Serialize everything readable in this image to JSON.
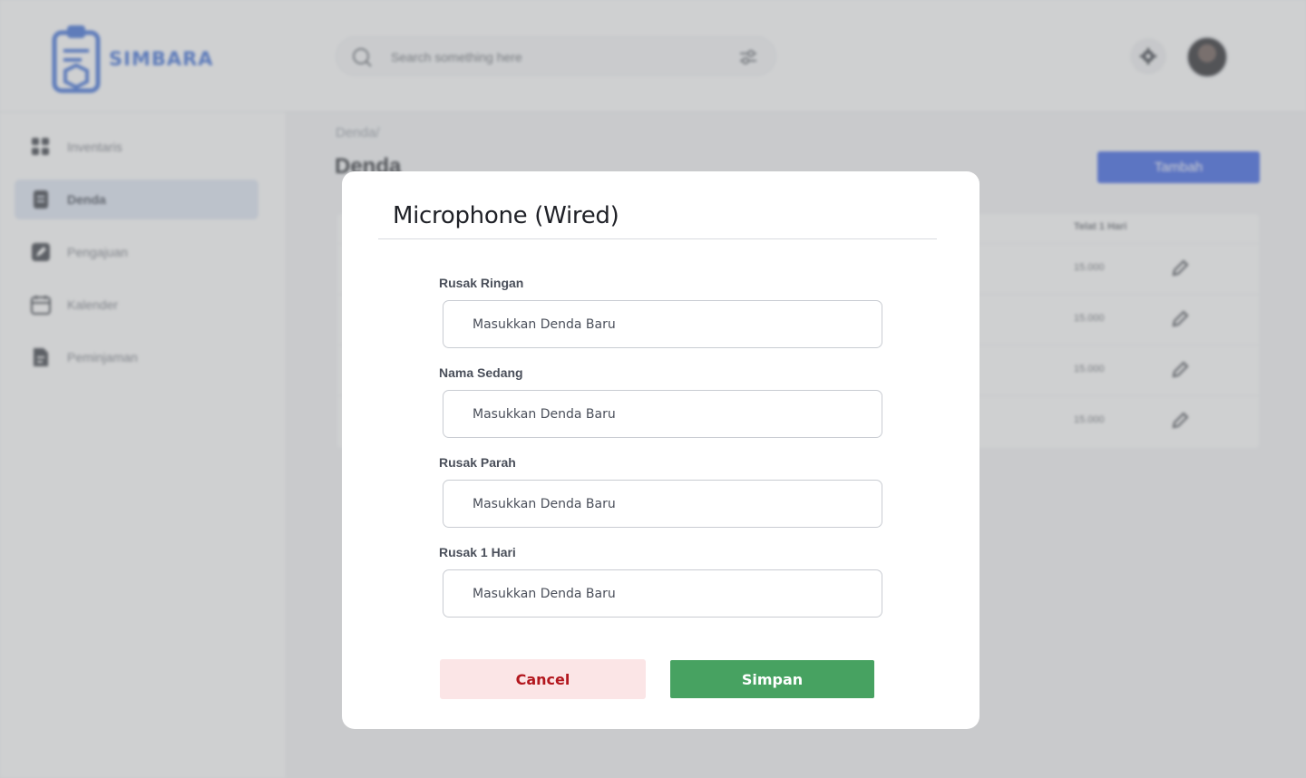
{
  "app": {
    "brand": "SIMBARA",
    "colors": {
      "brand": "#3e6fd8",
      "primary": "#3a62e6",
      "success": "#47a261",
      "danger": "#b3171e",
      "danger_bg": "#fbe5e6"
    }
  },
  "header": {
    "search_placeholder": "Search something here"
  },
  "sidebar": {
    "items": [
      {
        "label": "Inventaris",
        "icon": "grid-icon"
      },
      {
        "label": "Denda",
        "icon": "document-icon",
        "active": true
      },
      {
        "label": "Pengajuan",
        "icon": "edit-icon"
      },
      {
        "label": "Kalender",
        "icon": "calendar-icon"
      },
      {
        "label": "Peminjaman",
        "icon": "file-icon"
      }
    ]
  },
  "main": {
    "breadcrumb": "Denda/",
    "title": "Denda",
    "add_label": "Tambah",
    "table": {
      "last_column_header": "Telat 1 Hari",
      "rows": [
        {
          "value": "15.000"
        },
        {
          "value": "15.000"
        },
        {
          "value": "15.000"
        },
        {
          "value": "15.000"
        }
      ]
    }
  },
  "modal": {
    "title": "Microphone (Wired)",
    "fields": [
      {
        "label": "Rusak Ringan",
        "placeholder": "Masukkan Denda Baru"
      },
      {
        "label": "Nama Sedang",
        "placeholder": "Masukkan Denda Baru"
      },
      {
        "label": "Rusak Parah",
        "placeholder": "Masukkan Denda Baru"
      },
      {
        "label": "Rusak 1 Hari",
        "placeholder": "Masukkan Denda Baru"
      }
    ],
    "cancel_label": "Cancel",
    "save_label": "Simpan"
  }
}
